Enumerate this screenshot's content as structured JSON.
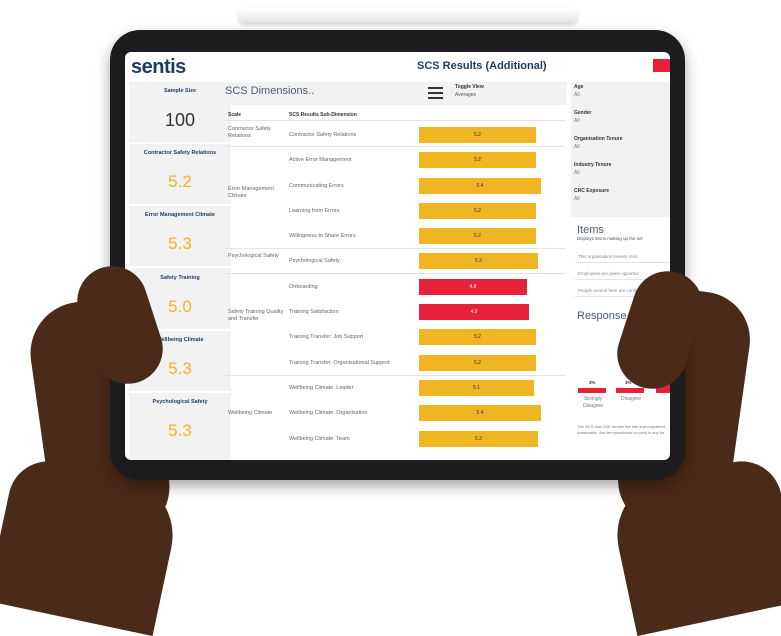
{
  "header": {
    "logo": "sentis",
    "title": "SCS Results (Additional)"
  },
  "kpis": [
    {
      "label": "Sample Size",
      "value": "100"
    },
    {
      "label": "Contractor Safety Relations",
      "value": "5.2"
    },
    {
      "label": "Error Management Climate",
      "value": "5.3"
    },
    {
      "label": "Safety Training",
      "value": "5.0"
    },
    {
      "label": "Wellbeing Climate",
      "value": "5.3"
    },
    {
      "label": "Psychological Safety",
      "value": "5.3"
    }
  ],
  "dimensions": {
    "title": "SCS Dimensions..",
    "toggle_label": "Toggle View",
    "toggle_value": "Averages",
    "col_scale": "Scale",
    "col_sub": "SCS Results Sub-Dimension",
    "scales": [
      "Contractor Safety Relations",
      "Error Management Climate",
      "Psychological Safety",
      "Safety Training Quality and Transfer",
      "Wellbeing Climate"
    ],
    "rows": [
      {
        "sub": "Contractor Safety Relations",
        "value": "5.2"
      },
      {
        "sub": "Active Error Management",
        "value": "5.2"
      },
      {
        "sub": "Communicating Errors",
        "value": "5.4"
      },
      {
        "sub": "Learning from Errors",
        "value": "5.2"
      },
      {
        "sub": "Willingness to Share Errors",
        "value": "5.2"
      },
      {
        "sub": "Psychological Safety",
        "value": "5.3"
      },
      {
        "sub": "Onboarding",
        "value": "4.8"
      },
      {
        "sub": "Training Satisfaction",
        "value": "4.9"
      },
      {
        "sub": "Training Transfer: Job Support",
        "value": "5.2"
      },
      {
        "sub": "Training Transfer: Organisational Support",
        "value": "5.2"
      },
      {
        "sub": "Wellbeing Climate: Leader",
        "value": "5.1"
      },
      {
        "sub": "Wellbeing Climate: Organisation",
        "value": "5.4"
      },
      {
        "sub": "Wellbeing Climate: Team",
        "value": "5.3"
      }
    ]
  },
  "filters": [
    {
      "label": "Age",
      "value": "All"
    },
    {
      "label": "Gender",
      "value": "All"
    },
    {
      "label": "Organisation Tenure",
      "value": "All"
    },
    {
      "label": "Industry Tenure",
      "value": "All"
    },
    {
      "label": "CRC Exposure",
      "value": "All"
    }
  ],
  "items": {
    "title": "Items",
    "subtitle": "Displays items making up the sel",
    "rows": [
      "This organisation invests reso",
      "Employees are given opportun",
      "People around here are confid"
    ]
  },
  "response": {
    "title": "Response Dis",
    "bars": [
      {
        "label": "Strongly Disagree",
        "pct": "3%"
      },
      {
        "label": "Disagree",
        "pct": "3%"
      }
    ],
    "footnote": "The SCS and OSE remain the inte and registered trademarks. Not be reproduced or used in any for"
  },
  "colors": {
    "bar_yellow": "#f0b522",
    "bar_red": "#e8213a",
    "brand_navy": "#1f3a5f"
  }
}
